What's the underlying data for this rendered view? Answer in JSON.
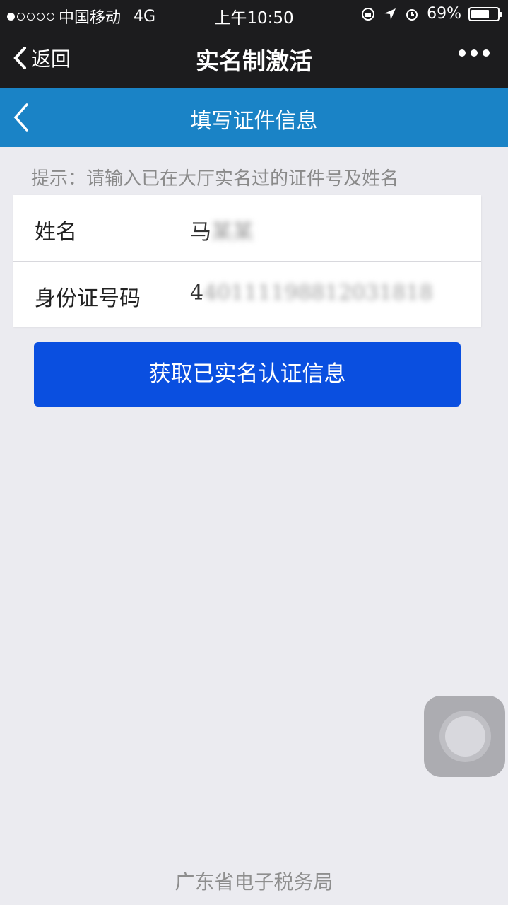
{
  "status_bar": {
    "carrier": "中国移动",
    "network": "4G",
    "time": "上午10:50",
    "battery": "69%",
    "battery_level": 0.69
  },
  "wechat_bar": {
    "back_label": "返回",
    "title": "实名制激活"
  },
  "page_header": {
    "title": "填写证件信息"
  },
  "hint": "提示：请输入已在大厅实名过的证件号及姓名",
  "form": {
    "name_label": "姓名",
    "name_value": "马",
    "name_blurred": "某某",
    "id_label": "身份证号码",
    "id_value": "4",
    "id_blurred": "40111198812031818"
  },
  "submit_button": "获取已实名认证信息",
  "footer": "广东省电子税务局",
  "colors": {
    "header_blue": "#1a83c6",
    "button_blue": "#0a4fe0"
  }
}
